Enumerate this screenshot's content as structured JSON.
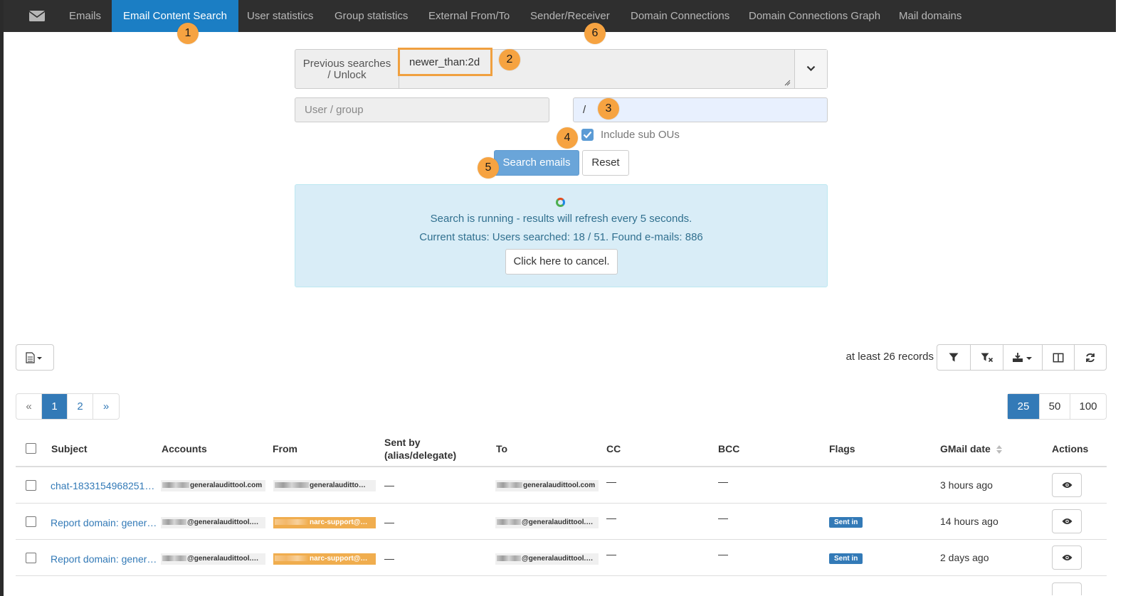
{
  "nav": {
    "mail_icon": "envelope-icon",
    "items": [
      "Emails",
      "Email Content Search",
      "User statistics",
      "Group statistics",
      "External From/To",
      "Sender/Receiver",
      "Domain Connections",
      "Domain Connections Graph",
      "Mail domains"
    ],
    "active": "Email Content Search"
  },
  "callouts": [
    "1",
    "2",
    "3",
    "4",
    "5",
    "6"
  ],
  "search": {
    "previous_label_line1": "Previous searches",
    "previous_label_line2": "/ Unlock",
    "query": "newer_than:2d",
    "user_group_placeholder": "User / group",
    "ou_value": "/",
    "include_sub_ous": "Include sub OUs",
    "include_sub_ous_checked": true,
    "search_button": "Search emails",
    "reset_button": "Reset"
  },
  "status": {
    "line1": "Search is running - results will refresh every 5 seconds.",
    "line2": "Current status: Users searched: 18 / 51. Found e-mails: 886",
    "cancel": "Click here to cancel."
  },
  "toolbar": {
    "records": "at least 26 records",
    "icons": [
      "filter-icon",
      "clear-filter-icon",
      "export-icon",
      "columns-icon",
      "refresh-icon"
    ]
  },
  "pagination": {
    "prev": "«",
    "pages": [
      "1",
      "2"
    ],
    "next": "»",
    "active_page": "1",
    "sizes": [
      "25",
      "50",
      "100"
    ],
    "active_size": "25"
  },
  "table": {
    "headers": {
      "subject": "Subject",
      "accounts": "Accounts",
      "from": "From",
      "sent_by_line1": "Sent by",
      "sent_by_line2": "(alias/delegate)",
      "to": "To",
      "cc": "CC",
      "bcc": "BCC",
      "flags": "Flags",
      "gmail_date": "GMail date",
      "actions": "Actions"
    },
    "rows": [
      {
        "subject": "chat-1833154968251…",
        "accounts": "generalaudittool.com",
        "from": "generalauditto…",
        "sent_by": "—",
        "to": "generalaudittool.com",
        "cc": "—",
        "bcc": "—",
        "flag": "",
        "date": "3 hours ago"
      },
      {
        "subject": "Report domain: gener…",
        "accounts": "@generalaudittool.…",
        "from": "narc-support@…",
        "sent_by": "—",
        "to": "@generalaudittool.…",
        "cc": "—",
        "bcc": "—",
        "flag": "Sent in",
        "date": "14 hours ago"
      },
      {
        "subject": "Report domain: gener…",
        "accounts": "@generalaudittool.…",
        "from": "narc-support@…",
        "sent_by": "—",
        "to": "@generalaudittool.…",
        "cc": "—",
        "bcc": "—",
        "flag": "Sent in",
        "date": "2 days ago"
      }
    ]
  },
  "colors": {
    "nav_bg": "#2f2f2f",
    "active_tab": "#1b7ec4",
    "callout": "#f6a341",
    "primary": "#337ab7",
    "info_bg": "#d9edf7"
  }
}
